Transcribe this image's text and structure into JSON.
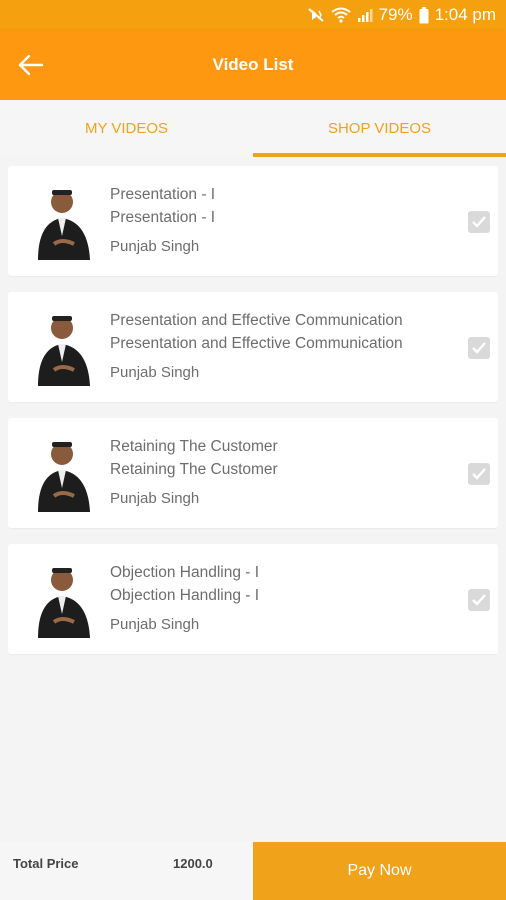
{
  "status_bar": {
    "battery": "79%",
    "time": "1:04 pm"
  },
  "app_bar": {
    "title": "Video List"
  },
  "tabs": [
    {
      "label": "MY VIDEOS"
    },
    {
      "label": "SHOP VIDEOS"
    }
  ],
  "videos": [
    {
      "title": "Presentation - I",
      "subtitle": "Presentation - I",
      "author": "Punjab Singh",
      "checked": true
    },
    {
      "title": "Presentation and Effective Communication",
      "subtitle": "Presentation and Effective Communication",
      "author": "Punjab Singh",
      "checked": true
    },
    {
      "title": "Retaining The Customer",
      "subtitle": "Retaining The Customer",
      "author": "Punjab Singh",
      "checked": true
    },
    {
      "title": "Objection Handling - I",
      "subtitle": "Objection Handling - I",
      "author": "Punjab Singh",
      "checked": true
    }
  ],
  "footer": {
    "total_label": "Total Price",
    "total_value": "1200.0",
    "pay_label": "Pay Now"
  },
  "colors": {
    "status_bar": "#f5a10f",
    "app_bar": "#ff9811",
    "accent": "#f0a21b",
    "checkbox": "#d9d9d9"
  },
  "icons": {
    "back": "arrow-left-icon",
    "mute": "vibrate-mute-icon",
    "wifi": "wifi-icon",
    "signal": "signal-icon",
    "battery": "battery-icon",
    "check": "check-icon"
  }
}
